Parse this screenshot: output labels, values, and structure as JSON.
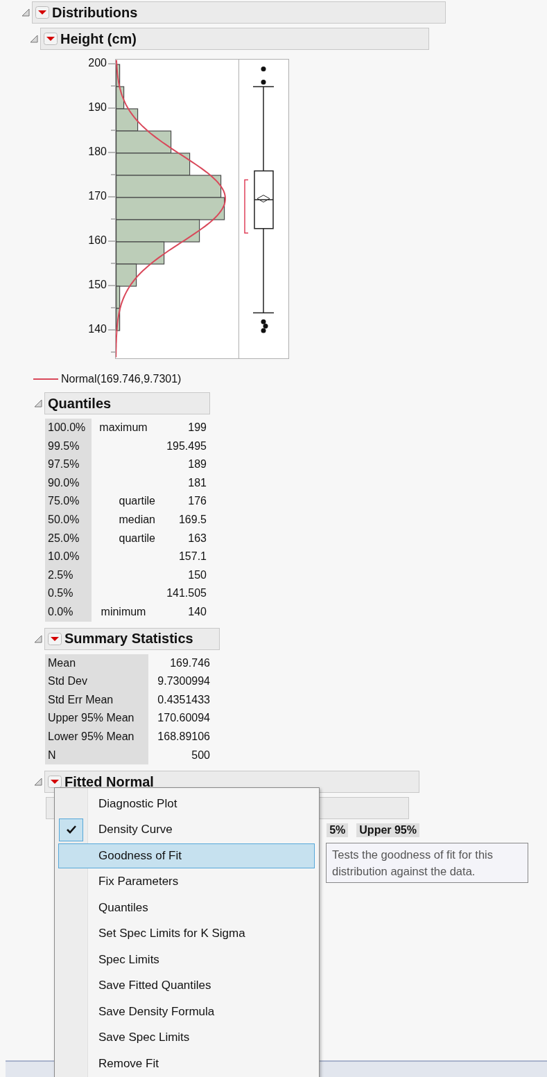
{
  "report": {
    "title": "Distributions",
    "expanded": true,
    "menu_button": true
  },
  "variable": {
    "title": "Height (cm)",
    "expanded": true,
    "menu_button": true,
    "axis_ticks": [
      "200",
      "190",
      "180",
      "170",
      "160",
      "150",
      "140"
    ],
    "legend": "Normal(169.746,9.7301)"
  },
  "quantiles": {
    "title": "Quantiles",
    "expanded": true,
    "menu_button": false,
    "rows": [
      {
        "percent": "100.0%",
        "label": "maximum",
        "value": "199"
      },
      {
        "percent": "99.5%",
        "label": "",
        "value": "195.495"
      },
      {
        "percent": "97.5%",
        "label": "",
        "value": "189"
      },
      {
        "percent": "90.0%",
        "label": "",
        "value": "181"
      },
      {
        "percent": "75.0%",
        "label": "quartile",
        "value": "176"
      },
      {
        "percent": "50.0%",
        "label": "median",
        "value": "169.5"
      },
      {
        "percent": "25.0%",
        "label": "quartile",
        "value": "163"
      },
      {
        "percent": "10.0%",
        "label": "",
        "value": "157.1"
      },
      {
        "percent": "2.5%",
        "label": "",
        "value": "150"
      },
      {
        "percent": "0.5%",
        "label": "",
        "value": "141.505"
      },
      {
        "percent": "0.0%",
        "label": "minimum",
        "value": "140"
      }
    ]
  },
  "summary_statistics": {
    "title": "Summary Statistics",
    "expanded": true,
    "menu_button": true,
    "rows": [
      {
        "label": "Mean",
        "value": "169.746"
      },
      {
        "label": "Std Dev",
        "value": "9.7300994"
      },
      {
        "label": "Std Err Mean",
        "value": "0.4351433"
      },
      {
        "label": "Upper 95% Mean",
        "value": "170.60094"
      },
      {
        "label": "Lower 95% Mean",
        "value": "168.89106"
      },
      {
        "label": "N",
        "value": "500"
      }
    ]
  },
  "fitted_normal": {
    "title": "Fitted Normal",
    "expanded": true,
    "menu_button": true,
    "column_headers": [
      "5%",
      "Upper 95%"
    ]
  },
  "context_menu": {
    "items": [
      {
        "label": "Diagnostic Plot",
        "checked": false,
        "selected": false
      },
      {
        "label": "Density Curve",
        "checked": true,
        "selected": false
      },
      {
        "label": "Goodness of Fit",
        "checked": false,
        "selected": true
      },
      {
        "label": "Fix Parameters",
        "checked": false,
        "selected": false
      },
      {
        "label": "Quantiles",
        "checked": false,
        "selected": false
      },
      {
        "label": "Set Spec Limits for K Sigma",
        "checked": false,
        "selected": false
      },
      {
        "label": "Spec Limits",
        "checked": false,
        "selected": false
      },
      {
        "label": "Save Fitted Quantiles",
        "checked": false,
        "selected": false
      },
      {
        "label": "Save Density Formula",
        "checked": false,
        "selected": false
      },
      {
        "label": "Save Spec Limits",
        "checked": false,
        "selected": false
      },
      {
        "label": "Remove Fit",
        "checked": false,
        "selected": false
      }
    ]
  },
  "tooltip": "Tests the goodness of fit for this distribution against the data."
}
